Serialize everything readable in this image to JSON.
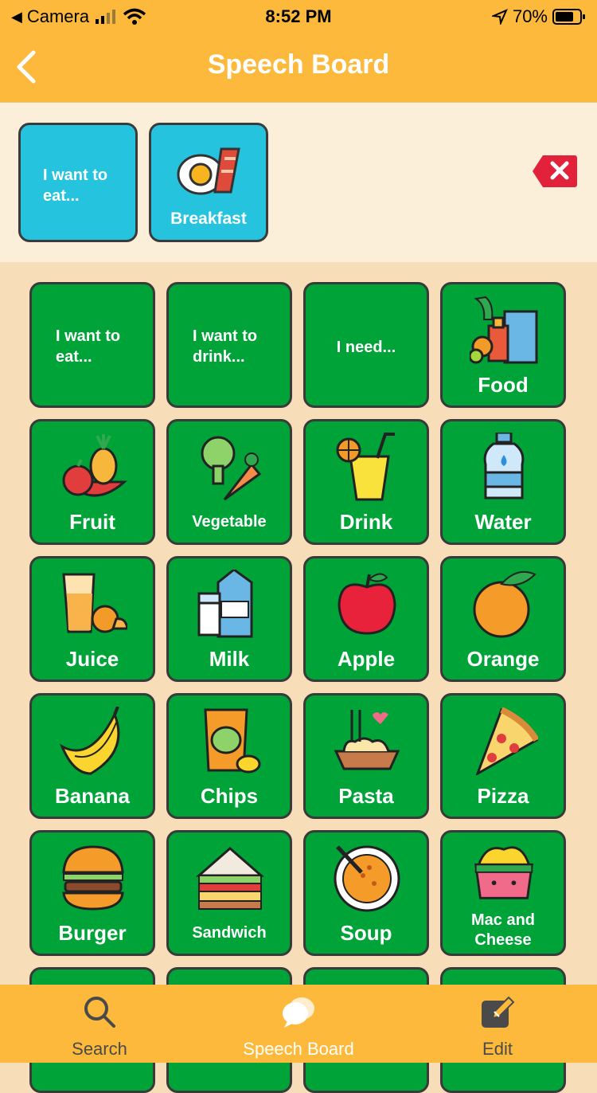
{
  "status": {
    "back_app": "Camera",
    "time": "8:52 PM",
    "battery": "70%"
  },
  "nav": {
    "title": "Speech Board"
  },
  "sentence": [
    {
      "text": "I want to eat...",
      "icon": "",
      "label": ""
    },
    {
      "text": "",
      "icon": "breakfast-icon",
      "label": "Breakfast"
    }
  ],
  "grid": [
    {
      "text": "I want to eat...",
      "label": "",
      "icon": ""
    },
    {
      "text": "I want to drink...",
      "label": "",
      "icon": ""
    },
    {
      "text": "I need...",
      "label": "",
      "icon": ""
    },
    {
      "text": "",
      "label": "Food",
      "icon": "grocery-icon"
    },
    {
      "text": "",
      "label": "Fruit",
      "icon": "fruit-icon"
    },
    {
      "text": "",
      "label": "Vegetable",
      "icon": "vegetable-icon"
    },
    {
      "text": "",
      "label": "Drink",
      "icon": "drink-icon"
    },
    {
      "text": "",
      "label": "Water",
      "icon": "water-bottle-icon"
    },
    {
      "text": "",
      "label": "Juice",
      "icon": "juice-icon"
    },
    {
      "text": "",
      "label": "Milk",
      "icon": "milk-icon"
    },
    {
      "text": "",
      "label": "Apple",
      "icon": "apple-icon"
    },
    {
      "text": "",
      "label": "Orange",
      "icon": "orange-icon"
    },
    {
      "text": "",
      "label": "Banana",
      "icon": "banana-icon"
    },
    {
      "text": "",
      "label": "Chips",
      "icon": "chips-icon"
    },
    {
      "text": "",
      "label": "Pasta",
      "icon": "pasta-icon"
    },
    {
      "text": "",
      "label": "Pizza",
      "icon": "pizza-icon"
    },
    {
      "text": "",
      "label": "Burger",
      "icon": "burger-icon"
    },
    {
      "text": "",
      "label": "Sandwich",
      "icon": "sandwich-icon"
    },
    {
      "text": "",
      "label": "Soup",
      "icon": "soup-icon"
    },
    {
      "text": "",
      "label": "Mac and Cheese",
      "icon": "mac-and-cheese-icon"
    }
  ],
  "tabs": [
    {
      "label": "Search",
      "icon": "search-icon"
    },
    {
      "label": "Speech Board",
      "icon": "chat-bubbles-icon"
    },
    {
      "label": "Edit",
      "icon": "edit-icon"
    }
  ],
  "colors": {
    "header": "#fdb93b",
    "tile": "#00a338",
    "sentence_tile": "#26c3df",
    "background": "#f7ddb8"
  }
}
